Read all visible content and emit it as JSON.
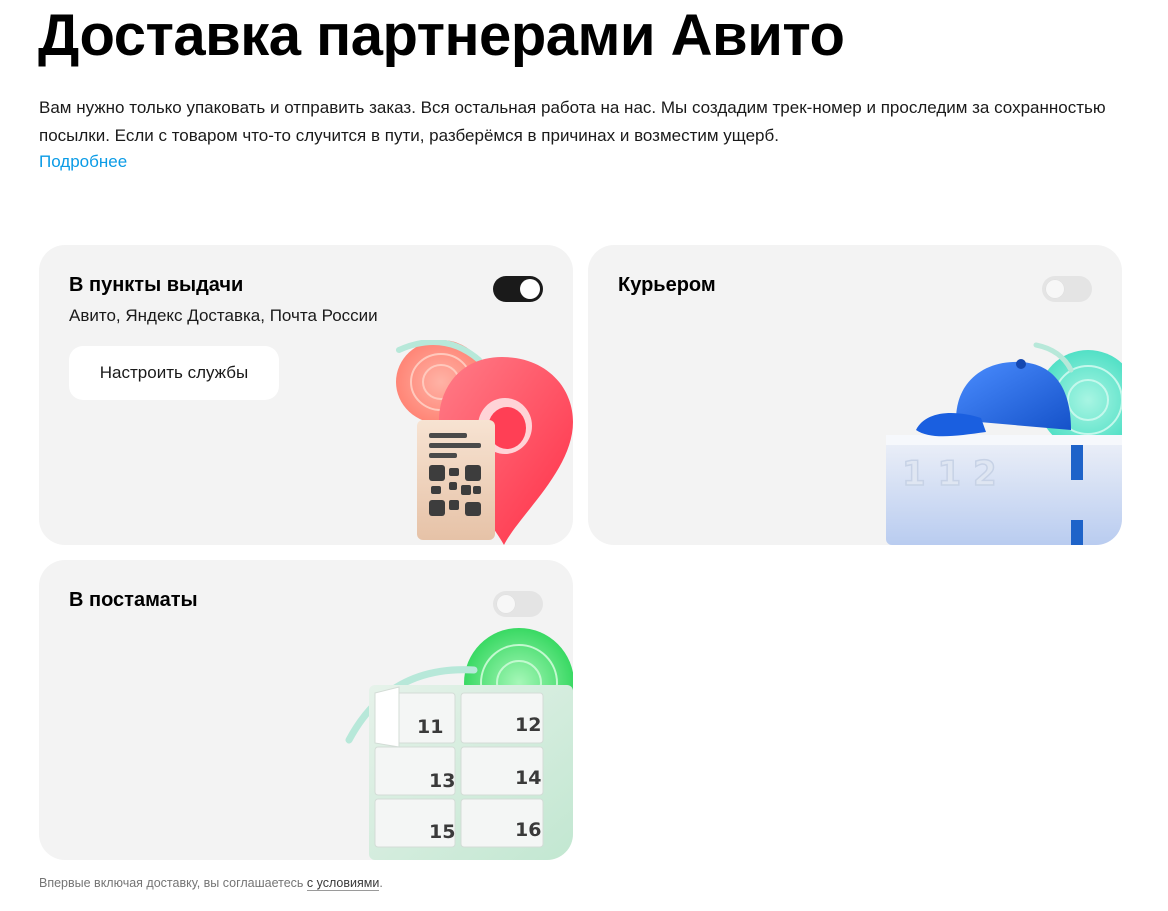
{
  "header": {
    "title": "Доставка партнерами Авито",
    "intro": "Вам нужно только упаковать и отправить заказ. Вся остальная работа на нас. Мы создадим трек-номер и проследим за сохранностью посылки. Если с товаром что-то случится в пути, разберёмся в причинах и возместим ущерб.",
    "more_link": "Подробнее"
  },
  "cards": {
    "pickup": {
      "title": "В пункты выдачи",
      "subtitle": "Авито, Яндекс Доставка, Почта России",
      "enabled": true,
      "button_label": "Настроить службы",
      "icon": "map-pin-illustration"
    },
    "courier": {
      "title": "Курьером",
      "enabled": false,
      "icon": "box-with-cap-illustration"
    },
    "lockers": {
      "title": "В постаматы",
      "enabled": false,
      "icon": "parcel-locker-illustration",
      "cell_numbers": [
        "11",
        "12",
        "13",
        "14",
        "15",
        "16"
      ]
    }
  },
  "footer": {
    "text": "Впервые включая доставку, вы соглашаетесь ",
    "link": "с условиями",
    "tail": "."
  },
  "colors": {
    "link": "#0a9be6",
    "card_bg": "#f3f3f3",
    "toggle_on": "#1a1a1a",
    "toggle_off": "#e4e4e4",
    "pin_red": "#ff4d5e",
    "cap_blue": "#1f6fe0",
    "locker_green": "#3ddc6a"
  }
}
